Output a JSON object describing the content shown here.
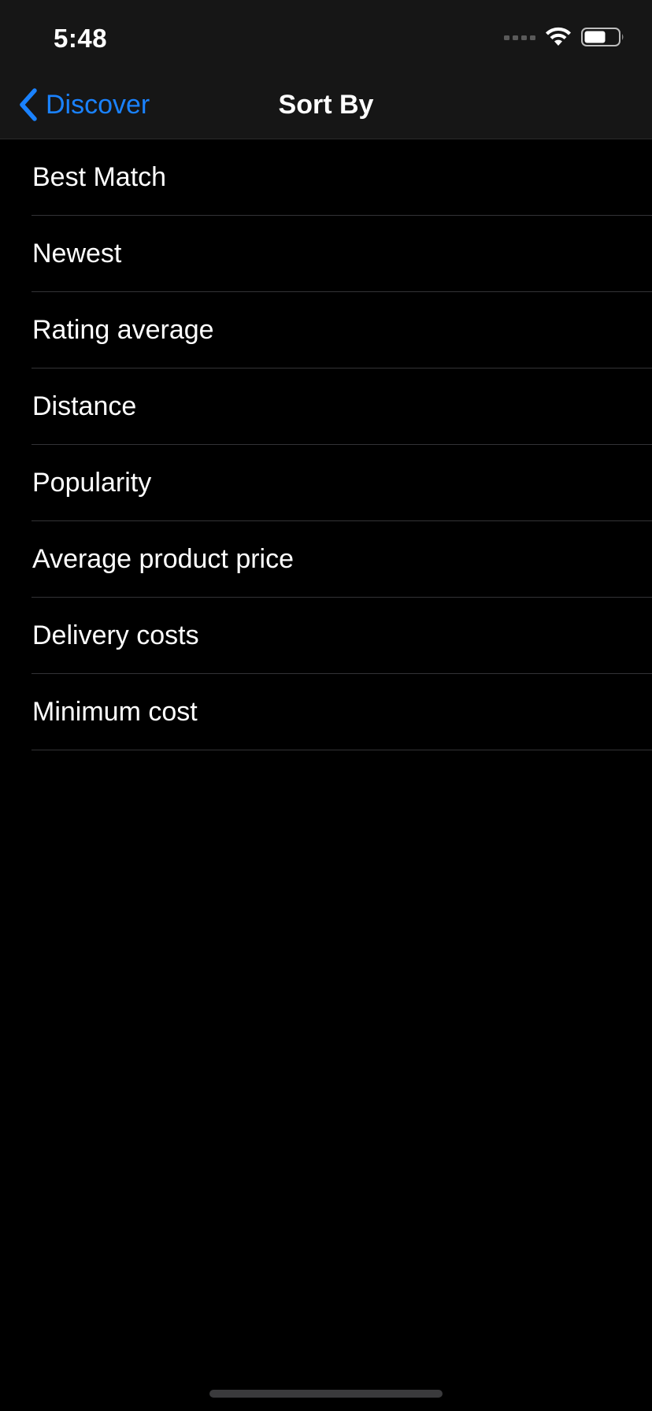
{
  "status_bar": {
    "time": "5:48",
    "icons": [
      "signal-icon",
      "wifi-icon",
      "battery-icon"
    ]
  },
  "nav": {
    "back_label": "Discover",
    "back_icon": "chevron-left-icon",
    "title": "Sort By"
  },
  "sort_options": [
    {
      "label": "Best Match"
    },
    {
      "label": "Newest"
    },
    {
      "label": "Rating average"
    },
    {
      "label": "Distance"
    },
    {
      "label": "Popularity"
    },
    {
      "label": "Average product price"
    },
    {
      "label": "Delivery costs"
    },
    {
      "label": "Minimum cost"
    }
  ],
  "colors": {
    "background": "#000000",
    "bar_background": "#161616",
    "accent": "#1a82ff",
    "separator": "#333336",
    "text": "#ffffff"
  }
}
